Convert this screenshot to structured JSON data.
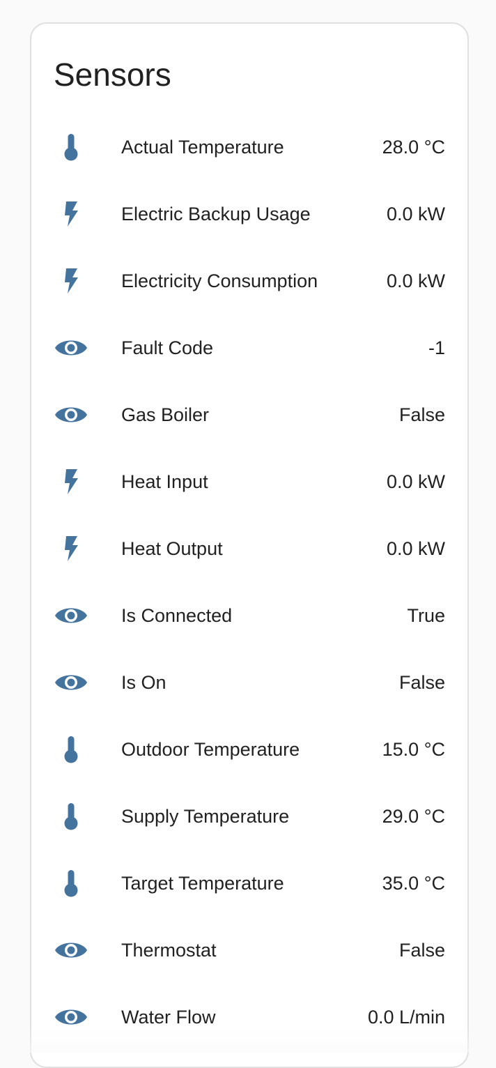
{
  "card": {
    "title": "Sensors"
  },
  "theme": {
    "icon_color": "#44739e",
    "text_color": "#212121"
  },
  "sensors": [
    {
      "icon": "thermometer-icon",
      "label": "Actual Temperature",
      "value": "28.0 °C"
    },
    {
      "icon": "flash-icon",
      "label": "Electric Backup Usage",
      "value": "0.0 kW"
    },
    {
      "icon": "flash-icon",
      "label": "Electricity Consumption",
      "value": "0.0 kW"
    },
    {
      "icon": "eye-icon",
      "label": "Fault Code",
      "value": "-1"
    },
    {
      "icon": "eye-icon",
      "label": "Gas Boiler",
      "value": "False"
    },
    {
      "icon": "flash-icon",
      "label": "Heat Input",
      "value": "0.0 kW"
    },
    {
      "icon": "flash-icon",
      "label": "Heat Output",
      "value": "0.0 kW"
    },
    {
      "icon": "eye-icon",
      "label": "Is Connected",
      "value": "True"
    },
    {
      "icon": "eye-icon",
      "label": "Is On",
      "value": "False"
    },
    {
      "icon": "thermometer-icon",
      "label": "Outdoor Temperature",
      "value": "15.0 °C"
    },
    {
      "icon": "thermometer-icon",
      "label": "Supply Temperature",
      "value": "29.0 °C"
    },
    {
      "icon": "thermometer-icon",
      "label": "Target Temperature",
      "value": "35.0 °C"
    },
    {
      "icon": "eye-icon",
      "label": "Thermostat",
      "value": "False"
    },
    {
      "icon": "eye-icon",
      "label": "Water Flow",
      "value": "0.0 L/min"
    }
  ]
}
